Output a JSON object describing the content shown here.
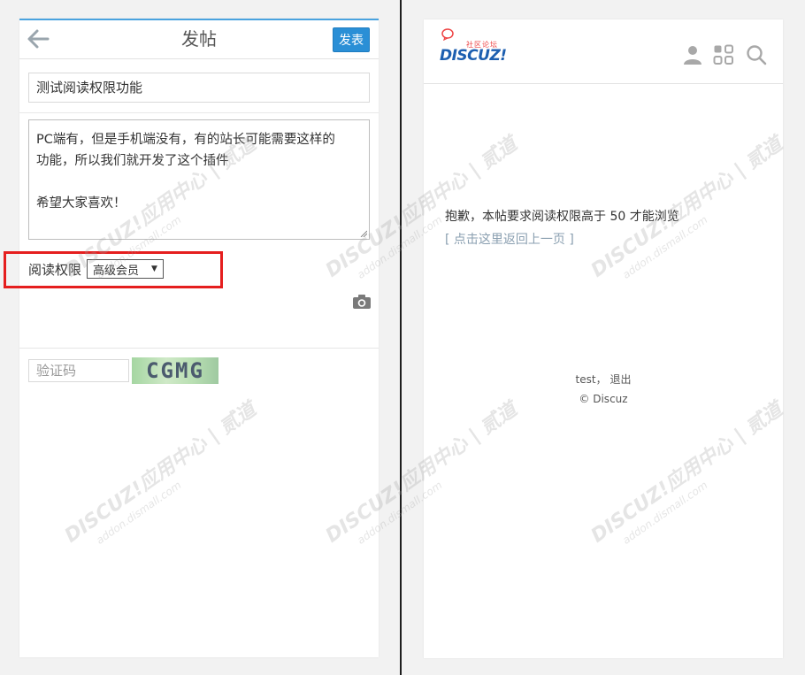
{
  "left": {
    "topbar": {
      "title": "发帖",
      "publish_label": "发表"
    },
    "form": {
      "title_value": "测试阅读权限功能",
      "content_lines": [
        "PC端有，但是手机端没有，有的站长可能需要这样的",
        "功能，所以我们就开发了这个插件",
        "",
        "希望大家喜欢！"
      ],
      "permission_label": "阅读权限",
      "permission_selected": "高级会员",
      "captcha_placeholder": "验证码",
      "captcha_text": "CGMG"
    }
  },
  "right": {
    "logo": {
      "sub": "社区论坛",
      "main": "DISCUZ!"
    },
    "message": "抱歉，本帖要求阅读权限高于 50 才能浏览",
    "back_link": "[ 点击这里返回上一页 ]",
    "footer": {
      "user": "test",
      "separator": "，",
      "logout": "退出",
      "copyright": "© Discuz"
    }
  },
  "watermark": {
    "main": "DISCUZ!应用中心 | 贰道",
    "sub": "addon.dismall.com"
  },
  "colors": {
    "accent": "#2a8fd6",
    "highlight": "#e51e1e",
    "link": "#8a9fb0",
    "logo": "#1d5fb0"
  }
}
